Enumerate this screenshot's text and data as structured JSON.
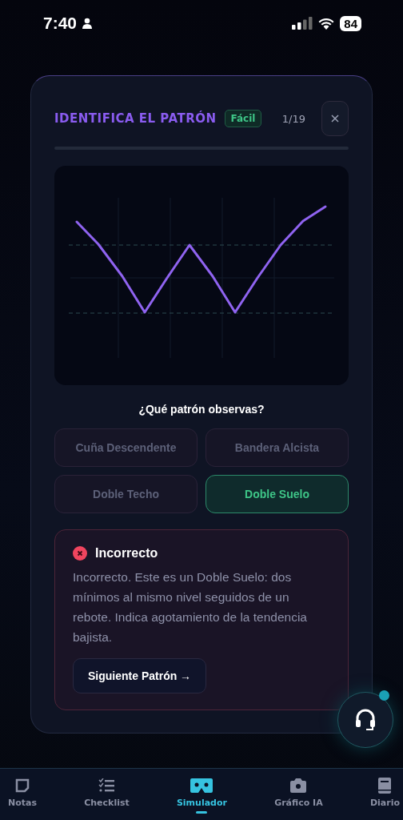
{
  "status_bar": {
    "time": "7:40",
    "battery": "84"
  },
  "quiz": {
    "title": "IDENTIFICA EL PATRÓN",
    "difficulty": "Fácil",
    "counter": "1/19",
    "question": "¿Qué patrón observas?",
    "options": [
      {
        "label": "Cuña Descendente",
        "correct": false
      },
      {
        "label": "Bandera Alcista",
        "correct": false
      },
      {
        "label": "Doble Techo",
        "correct": false
      },
      {
        "label": "Doble Suelo",
        "correct": true
      }
    ],
    "feedback": {
      "kind": "incorrect",
      "title": "Incorrecto",
      "text": "Incorrecto. Este es un Doble Suelo: dos mínimos al mismo nivel seguidos de un rebote. Indica agotamiento de la tendencia bajista.",
      "button": "Siguiente Patrón →"
    }
  },
  "nav": [
    {
      "kind": "notes",
      "label": "Notas",
      "selected": false
    },
    {
      "kind": "checklist",
      "label": "Checklist",
      "selected": false
    },
    {
      "kind": "vr",
      "label": "Simulador",
      "selected": true
    },
    {
      "kind": "camera",
      "label": "Gráfico IA",
      "selected": false
    },
    {
      "kind": "book",
      "label": "Diario",
      "selected": false
    }
  ]
}
